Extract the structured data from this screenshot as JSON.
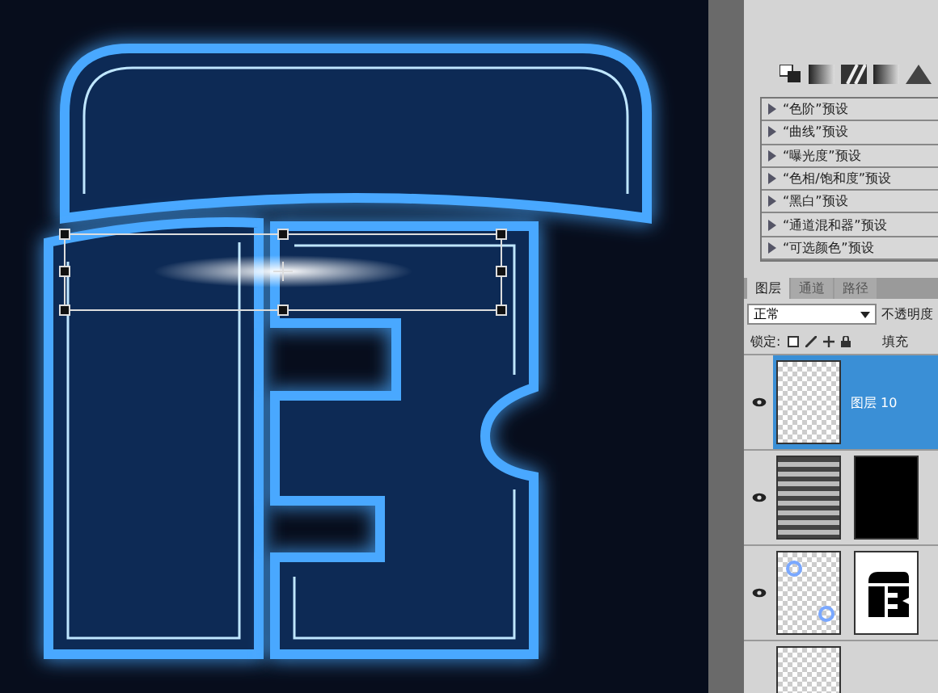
{
  "presets": [
    {
      "label": "“色阶”预设"
    },
    {
      "label": "“曲线”预设"
    },
    {
      "label": "“曝光度”预设"
    },
    {
      "label": "“色相/饱和度”预设"
    },
    {
      "label": "“黑白”预设"
    },
    {
      "label": "“通道混和器”预设"
    },
    {
      "label": "“可选颜色”预设"
    }
  ],
  "tabs": [
    {
      "label": "图层",
      "selected": true
    },
    {
      "label": "通道",
      "selected": false
    },
    {
      "label": "路径",
      "selected": false
    }
  ],
  "blend_mode": {
    "value": "正常"
  },
  "opacity_label": "不透明度",
  "lock_label": "锁定:",
  "fill_label": "填充",
  "layers": [
    {
      "name": "图层 10",
      "selected": true,
      "visible": true,
      "thumbnails": [
        {
          "kind": "transparent"
        }
      ]
    },
    {
      "selected": false,
      "visible": true,
      "thumbnails": [
        {
          "kind": "stripes"
        },
        {
          "kind": "blackmask"
        }
      ]
    },
    {
      "selected": false,
      "visible": true,
      "thumbnails": [
        {
          "kind": "sparkles"
        },
        {
          "kind": "lettermask"
        }
      ]
    },
    {
      "selected": false,
      "visible": false,
      "thumbnails": [
        {
          "kind": "transparent"
        }
      ]
    }
  ]
}
